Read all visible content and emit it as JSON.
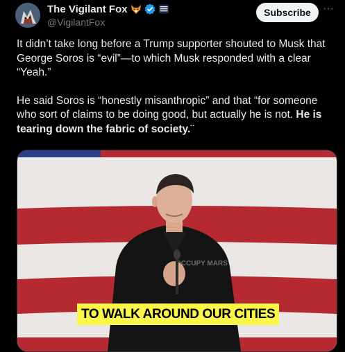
{
  "author": {
    "display_name": "The Vigilant Fox",
    "handle": "@VigilantFox",
    "badges": [
      "fox-emoji-icon",
      "verified-badge-icon",
      "affiliate-flag-icon"
    ]
  },
  "actions": {
    "subscribe_label": "Subscribe",
    "more_label": "···"
  },
  "tweet": {
    "paragraph1": "It didn’t take long before a Trump supporter shouted to Musk that George Soros is “evil”—to which Musk responded with a clear “Yeah.”",
    "paragraph2_plain": "He said Soros is “honestly misanthropic” and that “for someone who sort of claims to be doing good, but actually he is not. ",
    "paragraph2_bold": "He is tearing down the fabric of society",
    "paragraph2_end": ".¨"
  },
  "media": {
    "caption": "TO WALK AROUND OUR  CITIES",
    "shirt_text": "OCCUPY MARS"
  },
  "colors": {
    "background": "#000000",
    "text": "#e7e9ea",
    "muted": "#71767b",
    "verified": "#1d9bf0",
    "caption_bg": "#fbf64a",
    "flag_red": "#b52a30"
  }
}
